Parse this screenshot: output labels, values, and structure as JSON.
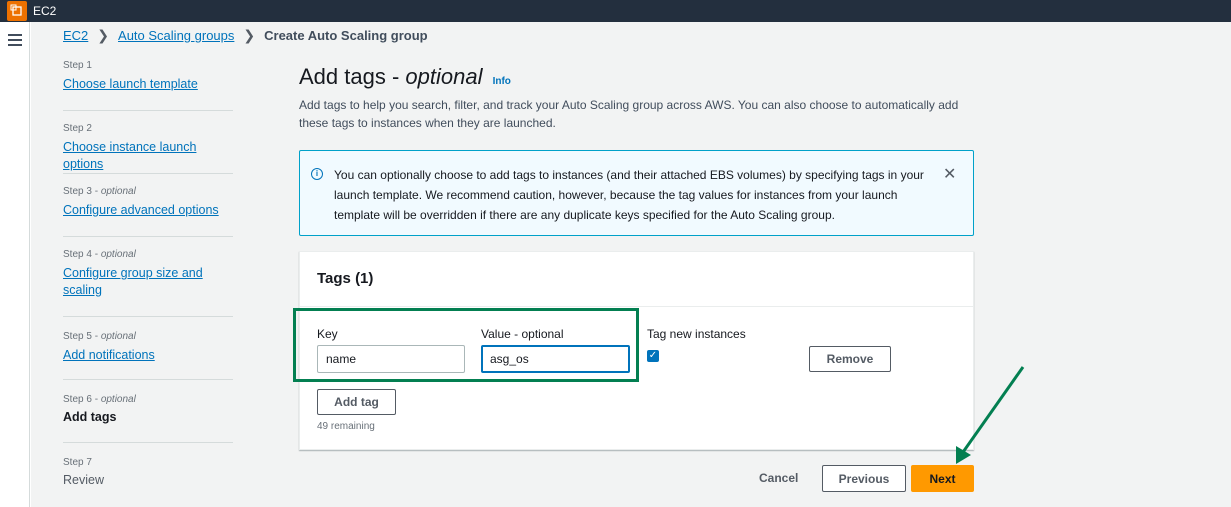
{
  "app": {
    "service_name": "EC2",
    "icon": "ec2-service-icon",
    "accent": "#ed7100"
  },
  "breadcrumb": {
    "item1": "EC2",
    "item2": "Auto Scaling groups",
    "current": "Create Auto Scaling group"
  },
  "steps": [
    {
      "title": "Step 1",
      "label": "Choose launch template"
    },
    {
      "title": "Step 2",
      "label": "Choose instance launch options"
    },
    {
      "title": "Step 3",
      "optional": "optional",
      "label": "Configure advanced options"
    },
    {
      "title": "Step 4",
      "optional": "optional",
      "label": "Configure group size and scaling"
    },
    {
      "title": "Step 5",
      "optional": "optional",
      "label": "Add notifications"
    },
    {
      "title": "Step 6",
      "optional": "optional",
      "label": "Add tags"
    },
    {
      "title": "Step 7",
      "label": "Review"
    }
  ],
  "page": {
    "title": "Add tags - ",
    "title_optional": "optional",
    "info": "Info",
    "description": "Add tags to help you search, filter, and track your Auto Scaling group across AWS. You can also choose to automatically add these tags to instances when they are launched."
  },
  "alert": {
    "text": "You can optionally choose to add tags to instances (and their attached EBS volumes) by specifying tags in your launch template. We recommend caution, however, because the tag values for instances from your launch template will be overridden if there are any duplicate keys specified for the Auto Scaling group."
  },
  "tags": {
    "header": "Tags (1)",
    "key_label": "Key",
    "value_label": "Value - optional",
    "tag_new_label": "Tag new instances",
    "key_value": "name",
    "value_value": "asg_os",
    "tag_new_checked": true,
    "remove_label": "Remove",
    "add_tag_label": "Add tag",
    "remaining": "49 remaining"
  },
  "footer": {
    "cancel": "Cancel",
    "previous": "Previous",
    "next": "Next"
  },
  "colors": {
    "link": "#0073bb",
    "primary_button": "#ff9900",
    "annotation": "#037f51"
  }
}
